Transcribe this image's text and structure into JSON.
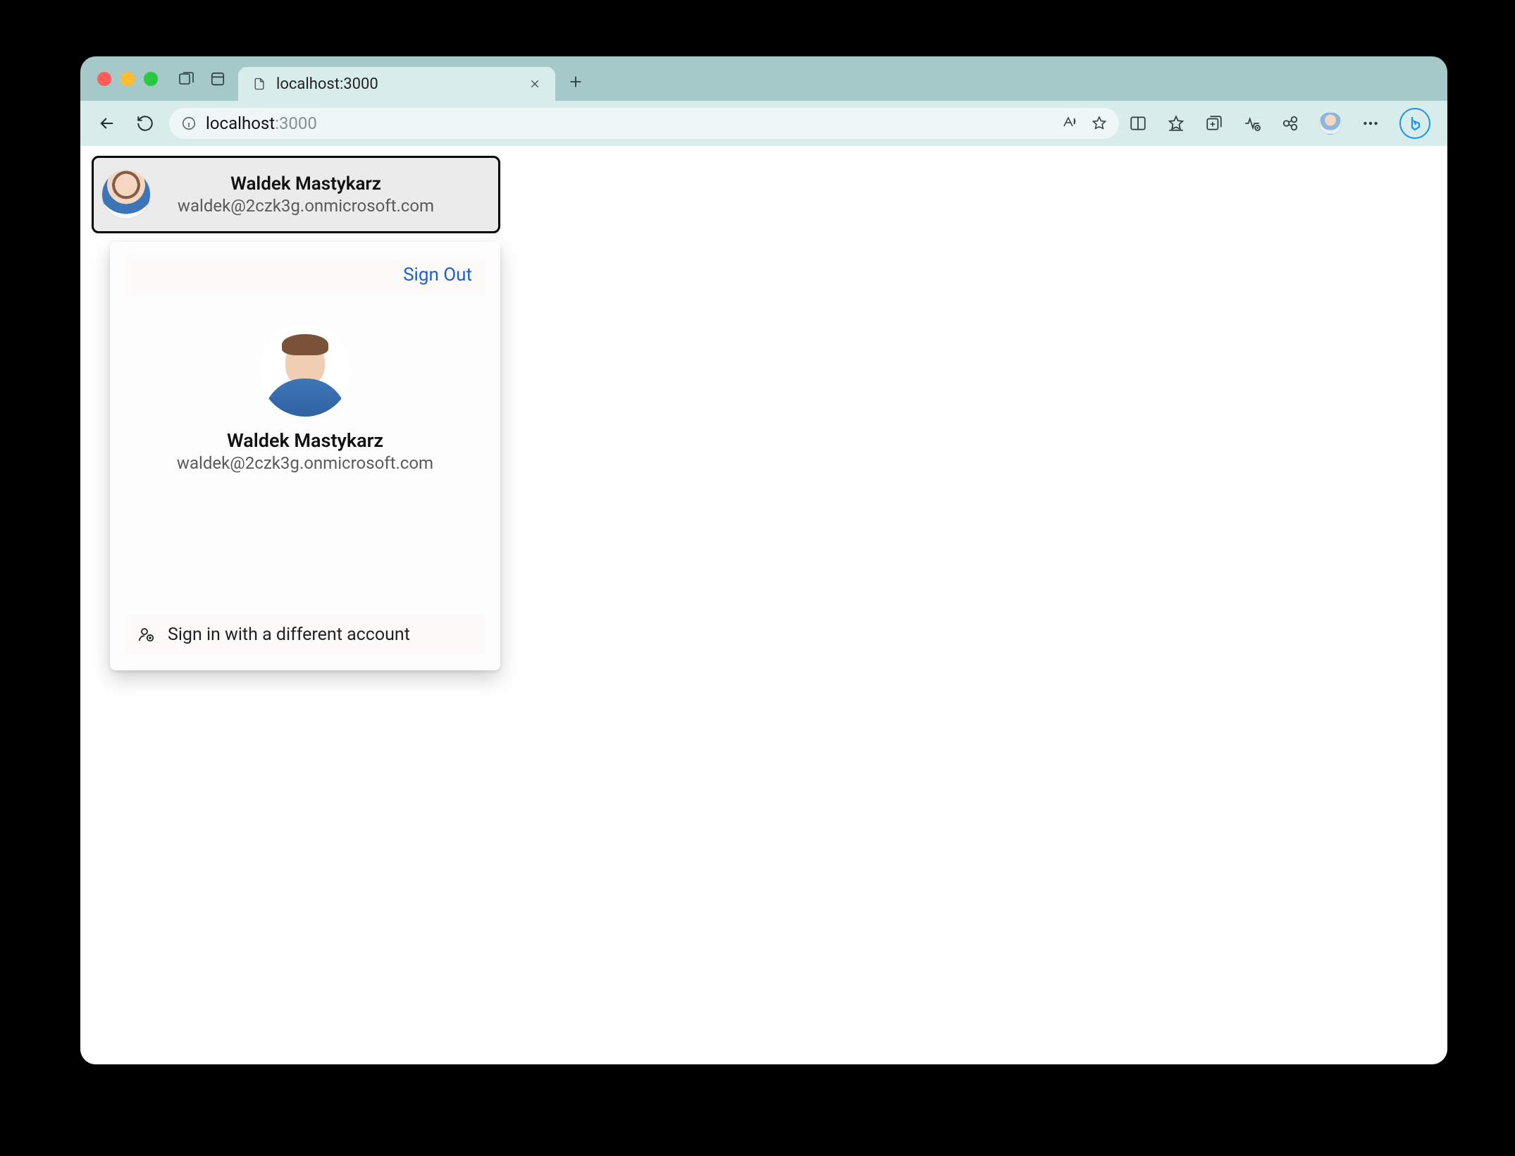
{
  "browser": {
    "tab": {
      "title": "localhost:3000"
    },
    "url": {
      "host": "localhost",
      "path": ":3000"
    }
  },
  "personChip": {
    "name": "Waldek Mastykarz",
    "email": "waldek@2czk3g.onmicrosoft.com"
  },
  "flyout": {
    "signOutLabel": "Sign Out",
    "profile": {
      "name": "Waldek Mastykarz",
      "email": "waldek@2czk3g.onmicrosoft.com"
    },
    "switchAccountLabel": "Sign in with a different account"
  }
}
